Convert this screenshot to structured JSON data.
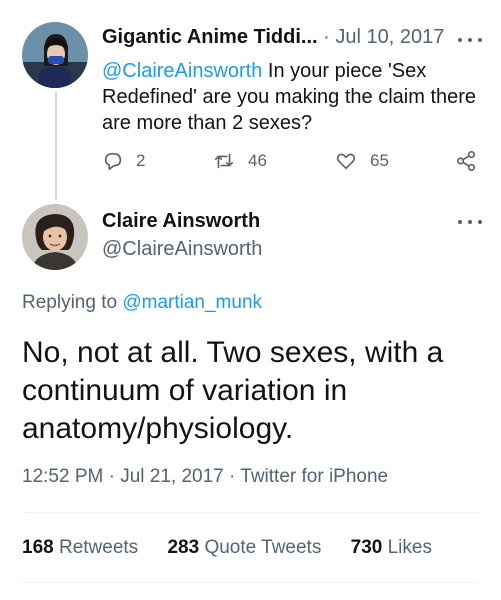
{
  "parent_tweet": {
    "display_name": "Gigantic Anime Tiddi...",
    "separator": "·",
    "date": "Jul 10, 2017",
    "mention": "@ClaireAinsworth",
    "text": "In your piece 'Sex Redefined' are you making the claim there are more than 2 sexes?",
    "replies": "2",
    "retweets": "46",
    "likes": "65"
  },
  "main_tweet": {
    "display_name": "Claire Ainsworth",
    "handle": "@ClaireAinsworth",
    "replying_prefix": "Replying to",
    "replying_to": "@martian_munk",
    "text": "No, not at all. Two sexes, with a continuum of variation in anatomy/physiology.",
    "timestamp": "12:52 PM · Jul 21, 2017 · Twitter for iPhone",
    "stats": {
      "retweets_count": "168",
      "retweets_label": "Retweets",
      "quotes_count": "283",
      "quotes_label": "Quote Tweets",
      "likes_count": "730",
      "likes_label": "Likes"
    }
  },
  "colors": {
    "accent": "#1d9bf0",
    "text_primary": "#0f1419",
    "text_secondary": "#536471",
    "divider": "#eff3f4"
  },
  "icons": [
    "reply-icon",
    "retweet-icon",
    "like-icon",
    "share-icon",
    "more-icon"
  ]
}
